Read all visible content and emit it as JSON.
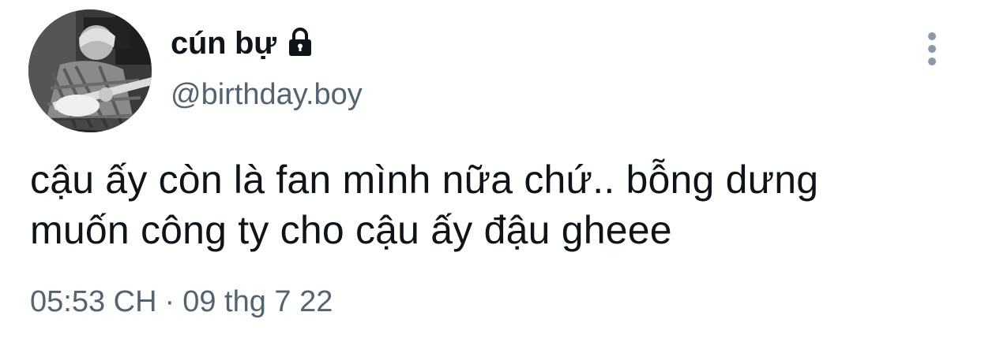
{
  "tweet": {
    "display_name": "cún bự",
    "handle": "@birthday.boy",
    "text_lines": [
      "cậu ấy còn là fan mình nữa chứ.. bỗng dưng",
      "muốn công ty cho cậu ấy đậu gheee"
    ],
    "time": "05:53 CH",
    "separator": "·",
    "date": "09 thg 7 22"
  },
  "icons": {
    "lock": "lock-icon",
    "more": "more-vertical-icon"
  },
  "colors": {
    "text": "#0f1419",
    "secondary": "#536471",
    "more_icon": "#8b98a5"
  }
}
